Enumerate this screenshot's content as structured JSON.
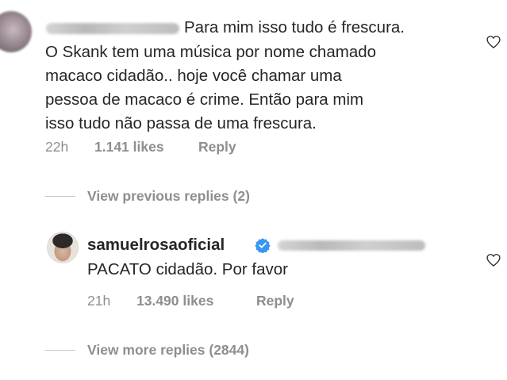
{
  "comment": {
    "text_line1": "Para mim isso tudo é frescura.",
    "text_line2": "O Skank  tem uma música por nome chamado",
    "text_line3": "macaco cidadão.. hoje você chamar uma",
    "text_line4": "pessoa de macaco é crime. Então para mim",
    "text_line5": "isso tudo não passa de uma frescura.",
    "time": "22h",
    "likes": "1.141 likes",
    "reply_label": "Reply"
  },
  "view_previous": "View previous replies (2)",
  "reply": {
    "username": "samuelrosaoficial",
    "text": "PACATO cidadão. Por favor",
    "time": "21h",
    "likes": "13.490 likes",
    "reply_label": "Reply"
  },
  "view_more": "View more replies (2844)",
  "icons": {
    "like": "heart-outline-icon",
    "verified": "verified-badge-icon"
  },
  "colors": {
    "text": "#262626",
    "muted": "#8e8e8e",
    "verified": "#3897f0"
  }
}
